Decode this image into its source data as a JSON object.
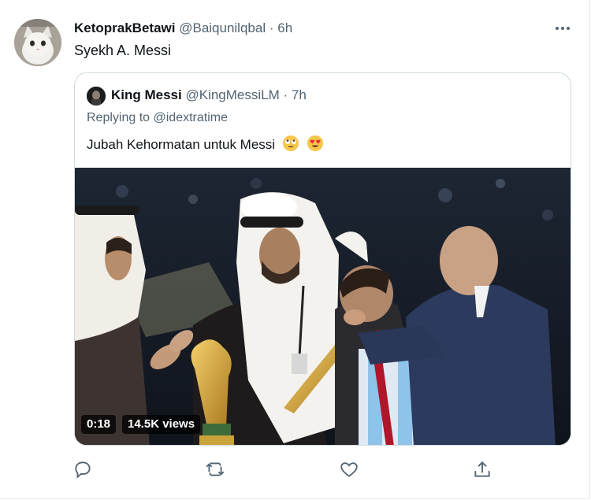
{
  "tweet": {
    "display_name": "KetoprakBetawi",
    "handle": "@Baiqunilqbal",
    "separator": "·",
    "time": "6h",
    "text": "Syekh A. Messi"
  },
  "quoted": {
    "display_name": "King Messi",
    "handle": "@KingMessiLM",
    "separator": "·",
    "time": "7h",
    "replying_prefix": "Replying to",
    "replying_to": "@idextratime",
    "text": "Jubah Kehormatan untuk Messi",
    "emojis": [
      "face-with-rolling-eyes-icon",
      "heart-eyes-icon"
    ],
    "video": {
      "duration": "0:18",
      "views": "14.5K views"
    }
  },
  "actions": [
    "reply-icon",
    "retweet-icon",
    "like-icon",
    "share-icon"
  ],
  "colors": {
    "text": "#0f1419",
    "muted": "#536471",
    "border": "#cfd9de"
  }
}
